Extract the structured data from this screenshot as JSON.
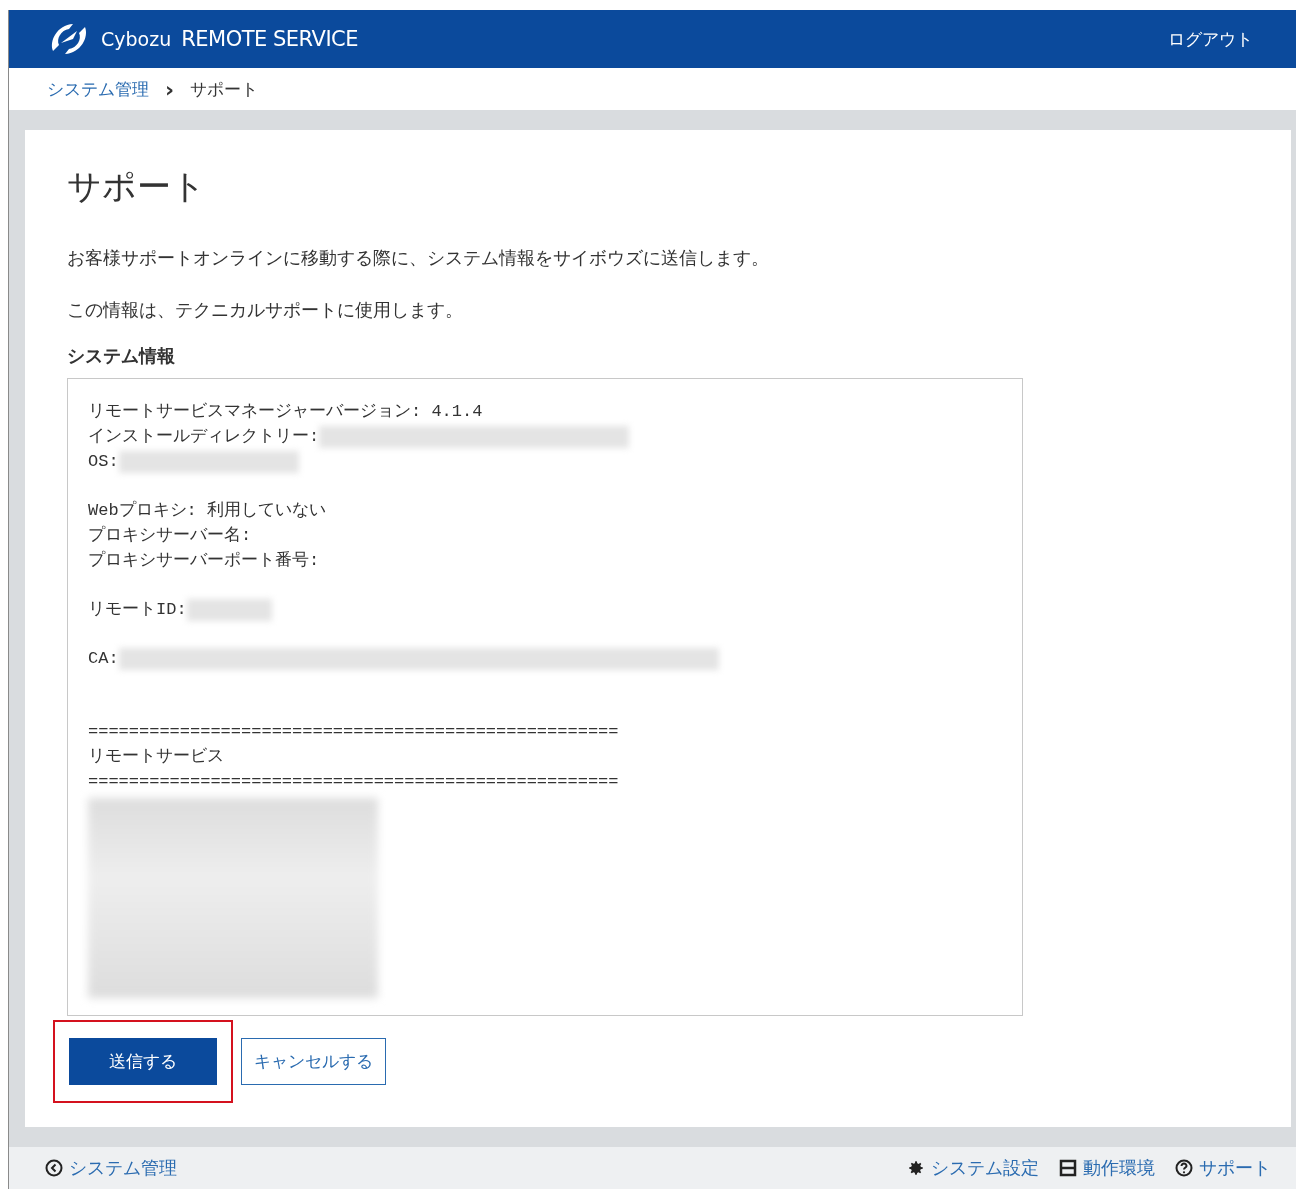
{
  "header": {
    "logo_text": "Cybozu",
    "product": "REMOTE SERVICE",
    "logout": "ログアウト"
  },
  "breadcrumb": {
    "parent": "システム管理",
    "separator": "›",
    "current": "サポート"
  },
  "page": {
    "title": "サポート",
    "paragraphs": [
      "お客様サポートオンラインに移動する際に、システム情報をサイボウズに送信します。",
      "この情報は、テクニカルサポートに使用します。"
    ],
    "section_heading": "システム情報"
  },
  "system_info": [
    {
      "kind": "line",
      "label": "リモートサービスマネージャーバージョン:",
      "value": "4.1.4"
    },
    {
      "kind": "redacted",
      "label": "インストールディレクトリー:"
    },
    {
      "kind": "redacted",
      "label": "OS:"
    },
    {
      "kind": "gap"
    },
    {
      "kind": "line",
      "label": "Webプロキシ:",
      "value": "利用していない"
    },
    {
      "kind": "line",
      "label": "プロキシサーバー名:"
    },
    {
      "kind": "line",
      "label": "プロキシサーバーポート番号:"
    },
    {
      "kind": "gap"
    },
    {
      "kind": "redacted",
      "label": "リモートID:"
    },
    {
      "kind": "gap"
    },
    {
      "kind": "redacted",
      "label": "CA:"
    },
    {
      "kind": "gap"
    },
    {
      "kind": "gap"
    },
    {
      "kind": "line",
      "label": "===================================================="
    },
    {
      "kind": "line",
      "label": "リモートサービス"
    },
    {
      "kind": "line",
      "label": "===================================================="
    },
    {
      "kind": "redacted_block"
    }
  ],
  "buttons": [
    {
      "label": "送信する",
      "primary": true,
      "highlighted": true
    },
    {
      "label": "キャンセルする",
      "primary": false,
      "highlighted": false
    }
  ],
  "footer": {
    "back": "システム管理",
    "links": [
      {
        "kind": "gear",
        "label": "システム設定"
      },
      {
        "kind": "env",
        "label": "動作環境"
      },
      {
        "kind": "help",
        "label": "サポート"
      }
    ]
  }
}
